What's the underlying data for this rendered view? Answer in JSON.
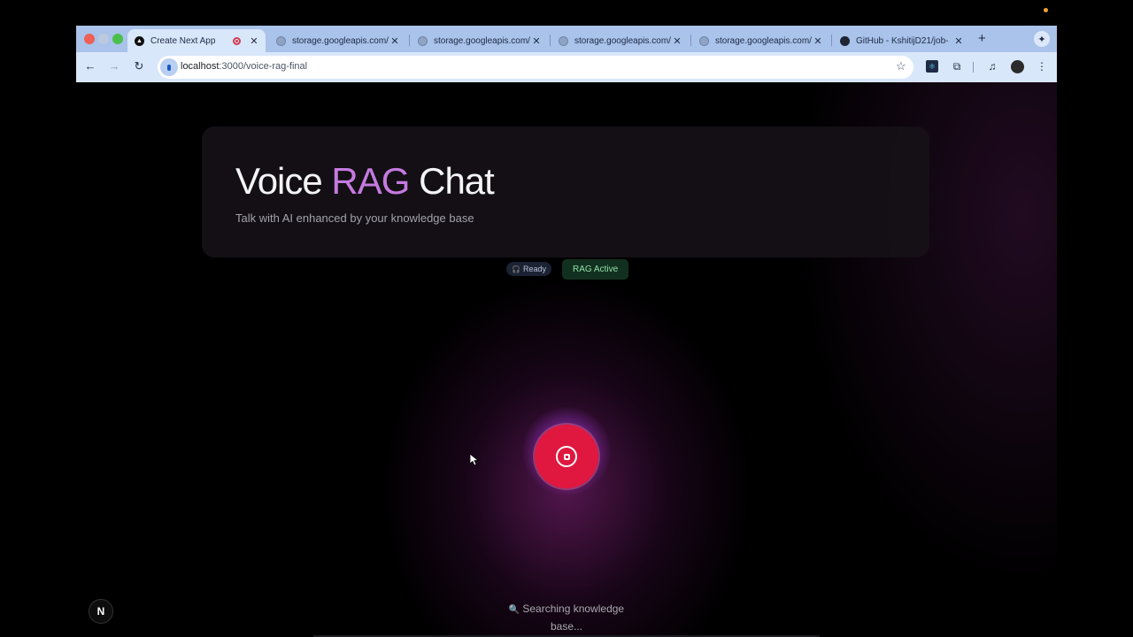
{
  "browser": {
    "tabs": [
      {
        "label": "Create Next App",
        "active": true,
        "favicon": "next-icon",
        "recording": true
      },
      {
        "label": "storage.googleapis.com/",
        "active": false,
        "favicon": "globe-icon"
      },
      {
        "label": "storage.googleapis.com/",
        "active": false,
        "favicon": "globe-icon"
      },
      {
        "label": "storage.googleapis.com/",
        "active": false,
        "favicon": "globe-icon"
      },
      {
        "label": "storage.googleapis.com/",
        "active": false,
        "favicon": "globe-icon"
      },
      {
        "label": "GitHub - KshitijD21/job-",
        "active": false,
        "favicon": "github-icon"
      }
    ],
    "new_tab_glyph": "+",
    "close_glyph": "✕",
    "url_host": "localhost",
    "url_path": ":3000/voice-rag-final"
  },
  "page": {
    "title_part1": "Voice ",
    "title_accent": "RAG",
    "title_part2": " Chat",
    "subtitle": "Talk with AI enhanced by your knowledge base",
    "status_badge": "Ready",
    "rag_badge": "RAG Active",
    "status_text": "Searching knowledge base...",
    "next_badge": "N"
  },
  "colors": {
    "accent": "#c57ae0",
    "record_button": "#e0173f",
    "rag_badge_text": "#8fe0a9",
    "tabstrip": "#a9c3ea",
    "toolbar": "#d9e7fb"
  }
}
